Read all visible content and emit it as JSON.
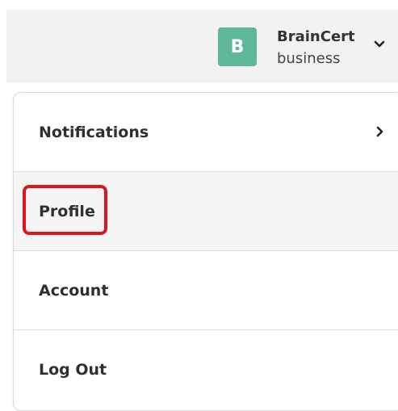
{
  "header": {
    "avatar_letter": "B",
    "account_name": "BrainCert",
    "account_type": "business",
    "avatar_color": "#5fb79c",
    "toggle_icon": "chevron-down-icon"
  },
  "menu": {
    "items": [
      {
        "label": "Notifications",
        "icon": "chevron-right-icon"
      },
      {
        "label": "Profile",
        "highlighted": true
      },
      {
        "label": "Account"
      },
      {
        "label": "Log Out"
      }
    ]
  },
  "annotation": {
    "highlight_color": "#e0151b",
    "target": "Profile"
  }
}
